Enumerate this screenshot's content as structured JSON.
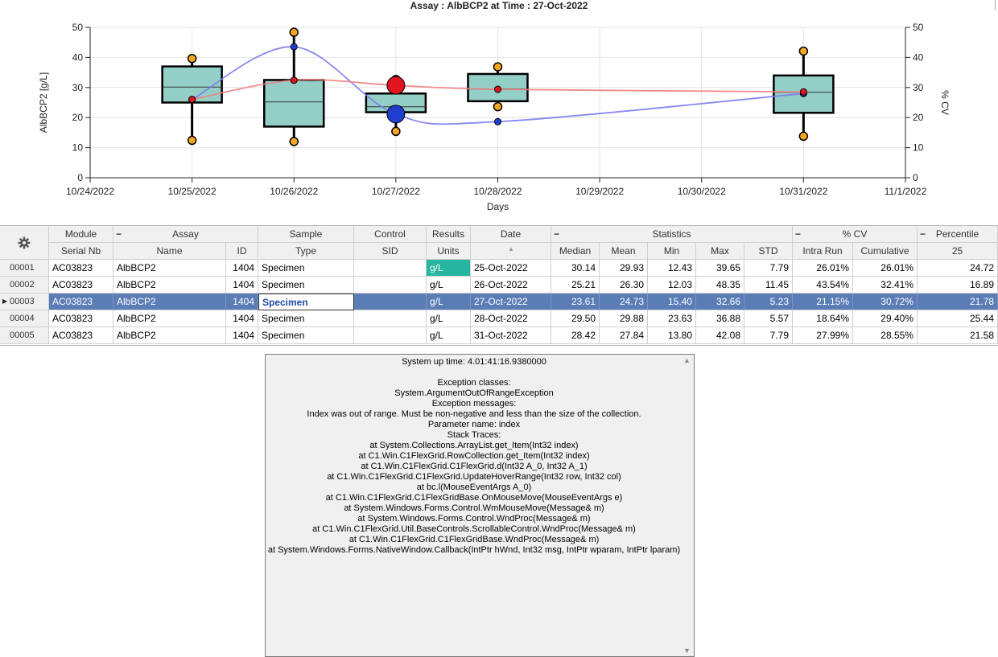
{
  "chart_data": {
    "type": "box",
    "title": "Assay : AlbBCP2  at Time : 27-Oct-2022",
    "xlabel": "Days",
    "ylabel": "AlbBCP2 [g/L]",
    "y2label": "% CV",
    "ylim": [
      0,
      50
    ],
    "y2lim": [
      0,
      50
    ],
    "yticks": [
      0,
      10,
      20,
      30,
      40,
      50
    ],
    "xticks": [
      "10/24/2022",
      "10/25/2022",
      "10/26/2022",
      "10/27/2022",
      "10/28/2022",
      "10/29/2022",
      "10/30/2022",
      "10/31/2022",
      "11/1/2022"
    ],
    "grid": true,
    "boxes": [
      {
        "date": "10/25/2022",
        "min": 12.43,
        "q1": 25,
        "median": 30.14,
        "q3": 37,
        "max": 39.65,
        "mean": 29.93
      },
      {
        "date": "10/26/2022",
        "min": 12.03,
        "q1": 17,
        "median": 25.21,
        "q3": 32.5,
        "max": 48.35,
        "mean": 26.3
      },
      {
        "date": "10/27/2022",
        "min": 15.4,
        "q1": 21.78,
        "median": 23.61,
        "q3": 28,
        "max": 32.66,
        "mean": 24.73
      },
      {
        "date": "10/28/2022",
        "min": 23.63,
        "q1": 25.44,
        "median": 29.5,
        "q3": 34.5,
        "max": 36.88,
        "mean": 29.88
      },
      {
        "date": "10/31/2022",
        "min": 13.8,
        "q1": 21.58,
        "median": 28.42,
        "q3": 34,
        "max": 42.08,
        "mean": 27.84
      }
    ],
    "series": [
      {
        "name": "Intra Run",
        "color": "#7b7bef",
        "axis": "y2",
        "x": [
          "10/25/2022",
          "10/26/2022",
          "10/27/2022",
          "10/28/2022",
          "10/31/2022"
        ],
        "values": [
          26.01,
          43.54,
          21.15,
          18.64,
          27.99
        ]
      },
      {
        "name": "Cumulative",
        "color": "#ef8080",
        "axis": "y2",
        "x": [
          "10/25/2022",
          "10/26/2022",
          "10/27/2022",
          "10/28/2022",
          "10/31/2022"
        ],
        "values": [
          26.01,
          32.41,
          30.72,
          29.4,
          28.55
        ]
      }
    ],
    "highlight_date": "10/27/2022",
    "colors": {
      "box_fill": "#94cfc7",
      "whisker_marker": "#f5a623",
      "intra_marker": "#1f3fd1",
      "cum_marker": "#e0151f"
    }
  },
  "grid": {
    "group_headers": {
      "module": "Module",
      "assay": "Assay",
      "sample": "Sample",
      "control": "Control",
      "results": "Results",
      "date": "Date",
      "statistics": "Statistics",
      "cv": "% CV",
      "percentile": "Percentile"
    },
    "collapse_glyph": "−",
    "columns": {
      "serial": "Serial Nb",
      "name": "Name",
      "id": "ID",
      "type": "Type",
      "sid": "SID",
      "units": "Units",
      "date": "",
      "median": "Median",
      "mean": "Mean",
      "min": "Min",
      "max": "Max",
      "std": "STD",
      "intra": "Intra Run",
      "cumulative": "Cumulative",
      "p25": "25"
    },
    "rows": [
      {
        "num": "00001",
        "serial": "AC03823",
        "name": "AlbBCP2",
        "id": "1404",
        "type": "Specimen",
        "sid": "",
        "units": "g/L",
        "date": "25-Oct-2022",
        "median": "30.14",
        "mean": "29.93",
        "min": "12.43",
        "max": "39.65",
        "std": "7.79",
        "intra": "26.01%",
        "cumulative": "26.01%",
        "p25": "24.72"
      },
      {
        "num": "00002",
        "serial": "AC03823",
        "name": "AlbBCP2",
        "id": "1404",
        "type": "Specimen",
        "sid": "",
        "units": "g/L",
        "date": "26-Oct-2022",
        "median": "25.21",
        "mean": "26.30",
        "min": "12.03",
        "max": "48.35",
        "std": "11.45",
        "intra": "43.54%",
        "cumulative": "32.41%",
        "p25": "16.89"
      },
      {
        "num": "00003",
        "serial": "AC03823",
        "name": "AlbBCP2",
        "id": "1404",
        "type": "Specimen",
        "sid": "",
        "units": "g/L",
        "date": "27-Oct-2022",
        "median": "23.61",
        "mean": "24.73",
        "min": "15.40",
        "max": "32.66",
        "std": "5.23",
        "intra": "21.15%",
        "cumulative": "30.72%",
        "p25": "21.78"
      },
      {
        "num": "00004",
        "serial": "AC03823",
        "name": "AlbBCP2",
        "id": "1404",
        "type": "Specimen",
        "sid": "",
        "units": "g/L",
        "date": "28-Oct-2022",
        "median": "29.50",
        "mean": "29.88",
        "min": "23.63",
        "max": "36.88",
        "std": "5.57",
        "intra": "18.64%",
        "cumulative": "29.40%",
        "p25": "25.44"
      },
      {
        "num": "00005",
        "serial": "AC03823",
        "name": "AlbBCP2",
        "id": "1404",
        "type": "Specimen",
        "sid": "",
        "units": "g/L",
        "date": "31-Oct-2022",
        "median": "28.42",
        "mean": "27.84",
        "min": "13.80",
        "max": "42.08",
        "std": "7.79",
        "intra": "27.99%",
        "cumulative": "28.55%",
        "p25": "21.58"
      }
    ],
    "selected_row": 2
  },
  "error": {
    "lines": [
      "System up time:      4.01:41:16.9380000",
      "",
      "Exception classes:",
      "System.ArgumentOutOfRangeException",
      "Exception messages:",
      "Index was out of range. Must be non-negative and less than the size of the collection.",
      "Parameter name: index",
      "Stack Traces:",
      "at System.Collections.ArrayList.get_Item(Int32 index)",
      "at C1.Win.C1FlexGrid.RowCollection.get_Item(Int32 index)",
      "at C1.Win.C1FlexGrid.C1FlexGrid.d(Int32 A_0, Int32 A_1)",
      "at C1.Win.C1FlexGrid.C1FlexGrid.UpdateHoverRange(Int32 row, Int32 col)",
      "at bc.l(MouseEventArgs A_0)",
      "at C1.Win.C1FlexGrid.C1FlexGridBase.OnMouseMove(MouseEventArgs e)",
      "at System.Windows.Forms.Control.WmMouseMove(Message& m)",
      "at System.Windows.Forms.Control.WndProc(Message& m)",
      "at C1.Win.C1FlexGrid.Util.BaseControls.ScrollableControl.WndProc(Message& m)",
      "at C1.Win.C1FlexGrid.C1FlexGridBase.WndProc(Message& m)",
      "at System.Windows.Forms.NativeWindow.Callback(IntPtr hWnd, Int32 msg, IntPtr wparam, IntPtr lparam)"
    ]
  }
}
